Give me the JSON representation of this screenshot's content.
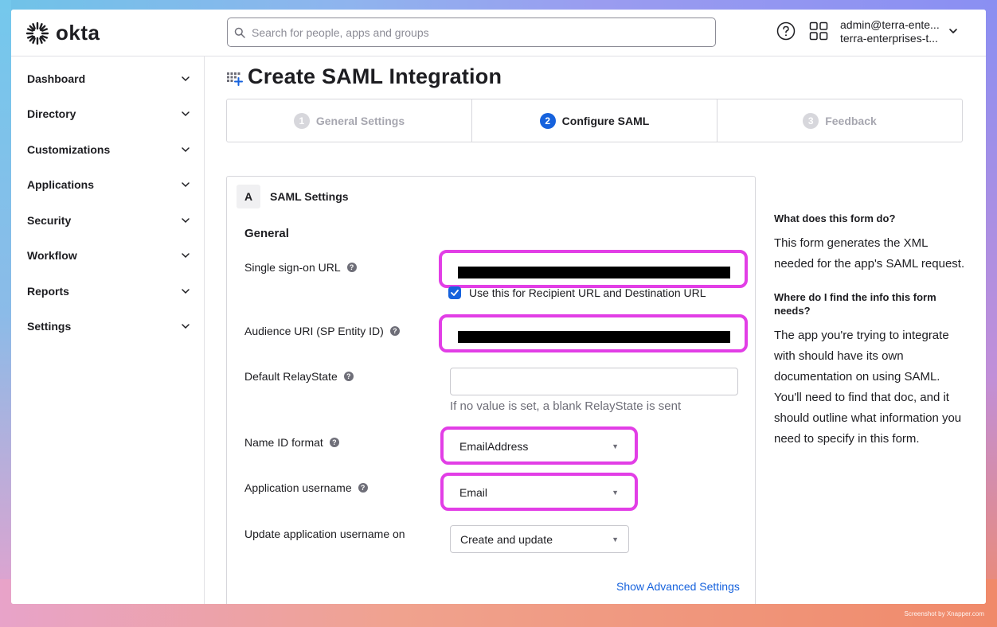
{
  "brand": {
    "logo_text": "okta"
  },
  "topbar": {
    "search_placeholder": "Search for people, apps and groups",
    "account_email": "admin@terra-ente...",
    "account_org": "terra-enterprises-t..."
  },
  "sidebar": {
    "items": [
      {
        "label": "Dashboard"
      },
      {
        "label": "Directory"
      },
      {
        "label": "Customizations"
      },
      {
        "label": "Applications"
      },
      {
        "label": "Security"
      },
      {
        "label": "Workflow"
      },
      {
        "label": "Reports"
      },
      {
        "label": "Settings"
      }
    ]
  },
  "page": {
    "title": "Create SAML Integration"
  },
  "steps": [
    {
      "num": "1",
      "label": "General Settings",
      "state": "inactive"
    },
    {
      "num": "2",
      "label": "Configure SAML",
      "state": "active"
    },
    {
      "num": "3",
      "label": "Feedback",
      "state": "inactive"
    }
  ],
  "form": {
    "section_letter": "A",
    "section_title": "SAML Settings",
    "group_title": "General",
    "sso_url_label": "Single sign-on URL",
    "recipient_checkbox_label": "Use this for Recipient URL and Destination URL",
    "audience_label": "Audience URI (SP Entity ID)",
    "relay_label": "Default RelayState",
    "relay_value": "",
    "relay_hint": "If no value is set, a blank RelayState is sent",
    "nameid_label": "Name ID format",
    "nameid_value": "EmailAddress",
    "username_label": "Application username",
    "username_value": "Email",
    "update_label": "Update application username on",
    "update_value": "Create and update",
    "advanced_link": "Show Advanced Settings"
  },
  "help": {
    "q1": "What does this form do?",
    "a1": "This form generates the XML needed for the app's SAML request.",
    "q2": "Where do I find the info this form needs?",
    "a2": "The app you're trying to integrate with should have its own documentation on using SAML. You'll need to find that doc, and it should outline what information you need to specify in this form."
  },
  "watermark": "Screenshot by Xnapper.com",
  "colors": {
    "accent": "#1662dd",
    "highlight": "#e23ee6"
  }
}
